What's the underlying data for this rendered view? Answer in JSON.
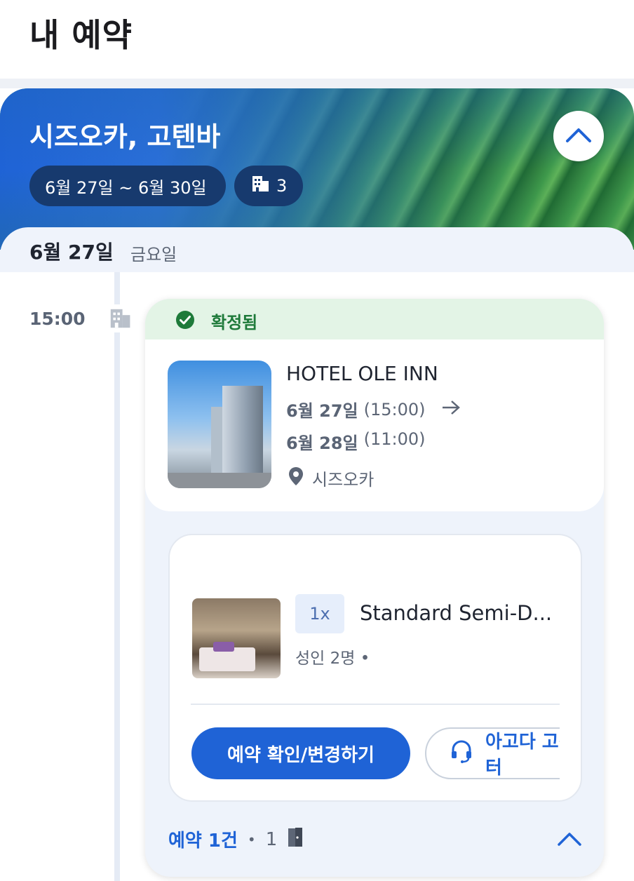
{
  "page": {
    "title": "내 예약"
  },
  "trip": {
    "title": "시즈오카, 고텐바",
    "date_range": "6월 27일 ~ 6월 30일",
    "property_count": "3",
    "collapse_icon": "chevron-up-icon"
  },
  "day": {
    "date": "6월 27일",
    "weekday": "금요일"
  },
  "timeline": {
    "time": "15:00",
    "icon": "hotel-building-icon"
  },
  "booking": {
    "status": "확정됨",
    "status_color": "#1e7a3a",
    "hotel": {
      "name": "HOTEL OLE INN",
      "checkin_date": "6월 27일",
      "checkin_time": "(15:00)",
      "checkout_date": "6월 28일",
      "checkout_time": "(11:00)",
      "location": "시즈오카"
    },
    "room": {
      "quantity": "1x",
      "name": "Standard Semi-D...",
      "guests": "성인 2명 •"
    },
    "actions": {
      "manage_label": "예약 확인/변경하기",
      "support_label": "아고다 고객센터"
    },
    "summary": {
      "count_label": "예약 1건",
      "separator": "•",
      "rooms": "1"
    }
  },
  "colors": {
    "brand_blue": "#1f63d6",
    "confirmed_bg": "#e3f4e6",
    "chip_bg": "#173a6e"
  }
}
